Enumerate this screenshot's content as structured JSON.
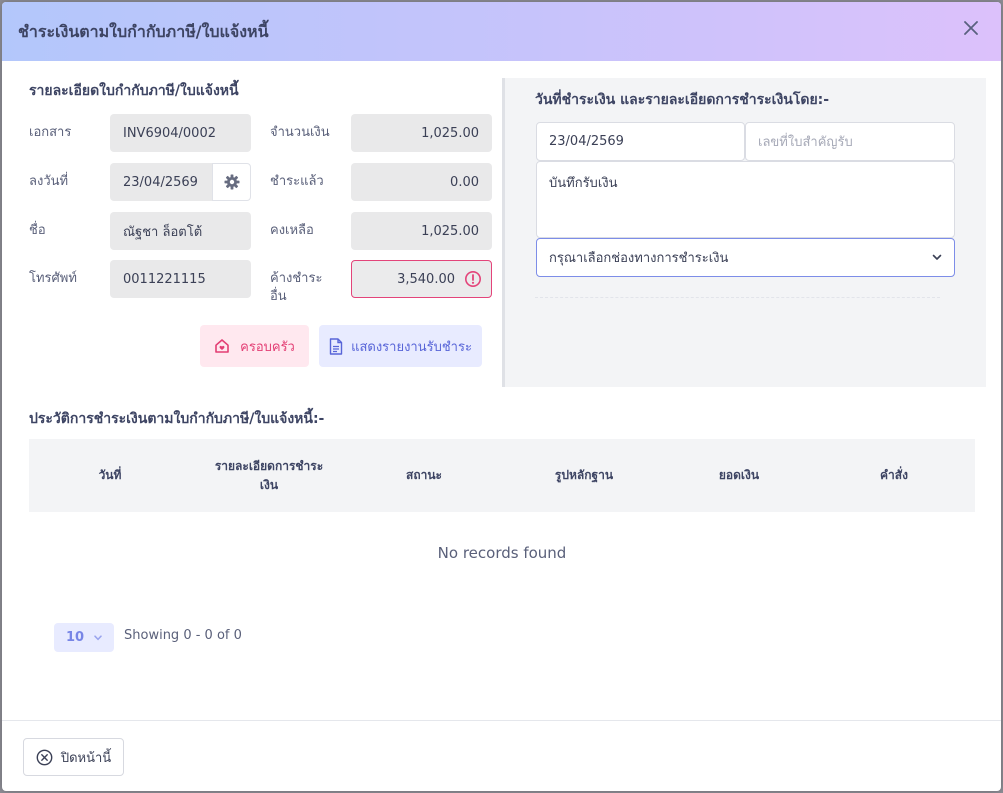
{
  "modal": {
    "title": "ชำระเงินตามใบกำกับภาษี/ใบแจ้งหนี้"
  },
  "invoice": {
    "section_title": "รายละเอียดใบกำกับภาษี/ใบแจ้งหนี้",
    "document_label": "เอกสาร",
    "document_value": "INV6904/0002",
    "date_label": "ลงวันที่",
    "date_value": "23/04/2569",
    "name_label": "ชื่อ",
    "name_value": "ณัฐชา ล็อตโต้",
    "phone_label": "โทรศัพท์",
    "phone_value": "0011221115",
    "amount_label": "จำนวนเงิน",
    "amount_value": "1,025.00",
    "paid_label": "ชำระแล้ว",
    "paid_value": "0.00",
    "remaining_label": "คงเหลือ",
    "remaining_value": "1,025.00",
    "other_due_label": "ค้างชำระอื่น",
    "other_due_value": "3,540.00",
    "family_button": "ครอบครัว",
    "report_button": "แสดงรายงานรับชำระ"
  },
  "payment": {
    "section_title": "วันที่ชำระเงิน และรายละเอียดการชำระเงินโดย:-",
    "date_value": "23/04/2569",
    "receipt_placeholder": "เลขที่ใบสำคัญรับ",
    "note_value": "บันทึกรับเงิน",
    "channel_placeholder": "กรุณาเลือกช่องทางการชำระเงิน"
  },
  "history": {
    "section_title": "ประวัติการชำระเงินตามใบกำกับภาษี/ใบแจ้งหนี้:-",
    "columns": [
      "วันที่",
      "รายละเอียดการชำระเงิน",
      "สถานะ",
      "รูปหลักฐาน",
      "ยอดเงิน",
      "คำสั่ง"
    ],
    "empty_text": "No records found",
    "page_size": "10",
    "showing_text": "Showing 0 - 0 of 0"
  },
  "footer": {
    "close_button": "ปิดหน้านี้"
  },
  "colors": {
    "accent": "#7785e6",
    "danger": "#e3447a",
    "header_start": "#b3c7fb",
    "header_end": "#dcc1fb"
  }
}
